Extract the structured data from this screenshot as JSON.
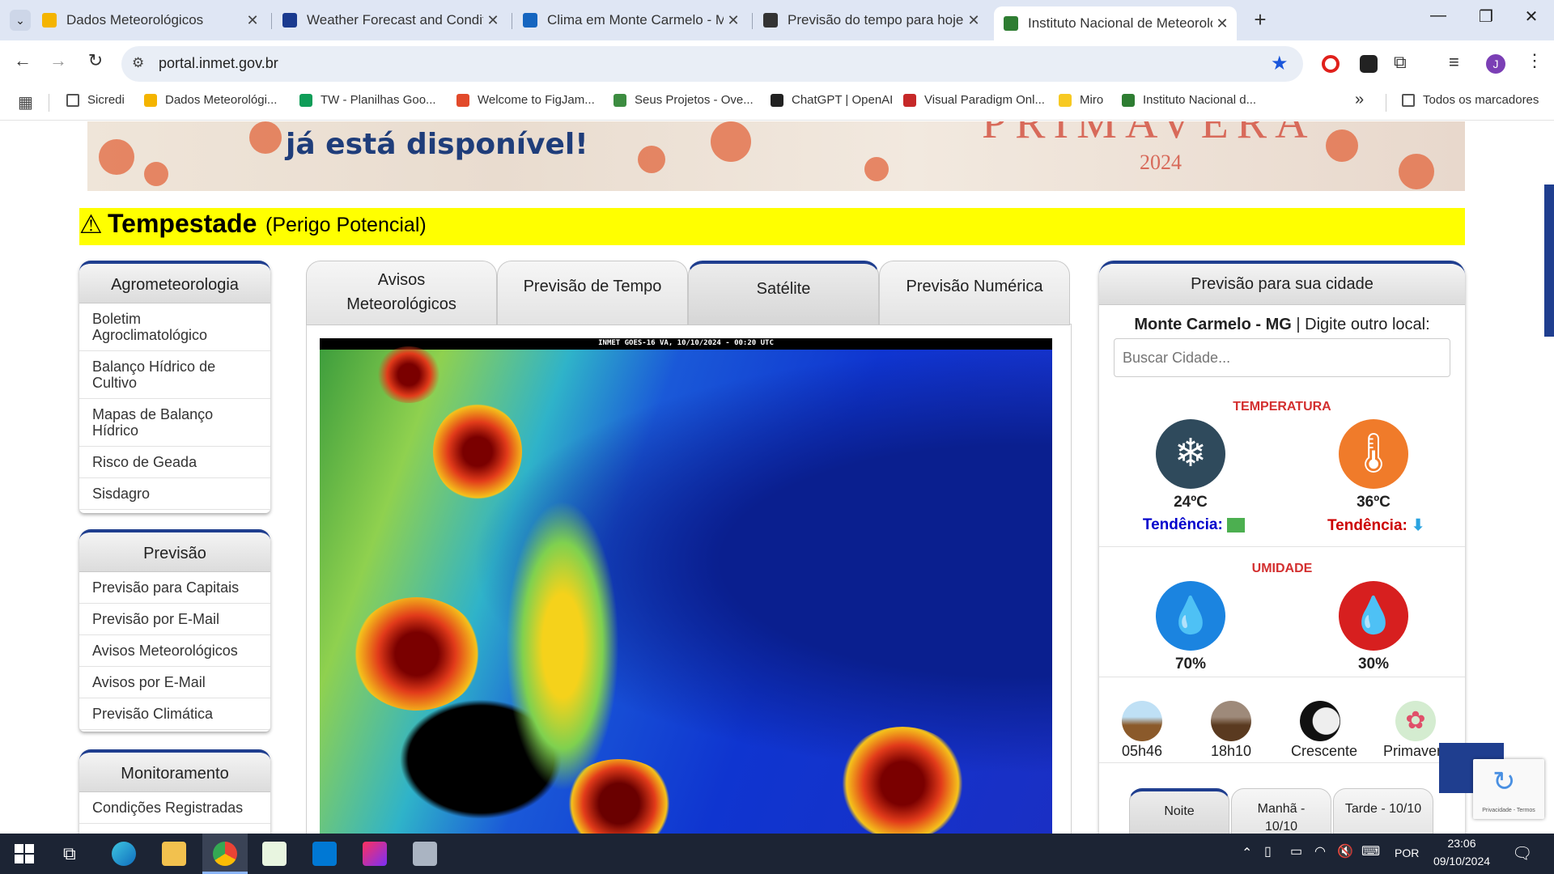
{
  "browser": {
    "tabs": [
      {
        "title": "Dados Meteorológicos",
        "icon": "sun-cloud-icon",
        "color": "#f4b400",
        "active": false
      },
      {
        "title": "Weather Forecast and Condition",
        "icon": "weather-channel-icon",
        "color": "#1a3a8f",
        "active": false
      },
      {
        "title": "Clima em Monte Carmelo - MG",
        "icon": "climate-icon",
        "color": "#1565c0",
        "active": false
      },
      {
        "title": "Previsão do tempo para hoje em",
        "icon": "tempo-agora-icon",
        "color": "#333333",
        "active": false
      },
      {
        "title": "Instituto Nacional de Meteorolo",
        "icon": "inmet-icon",
        "color": "#2e7d32",
        "active": true
      }
    ],
    "new_tab": "+",
    "url": "portal.inmet.gov.br",
    "bookmarks": [
      {
        "label": "Sicredi",
        "icon": "folder-icon",
        "color": "#555555"
      },
      {
        "label": "Dados Meteorológi...",
        "icon": "sun-cloud-icon",
        "color": "#f4b400"
      },
      {
        "label": "TW - Planilhas Goo...",
        "icon": "sheets-icon",
        "color": "#0f9d58"
      },
      {
        "label": "Welcome to FigJam...",
        "icon": "figma-icon",
        "color": "#e24a2b"
      },
      {
        "label": "Seus Projetos - Ove...",
        "icon": "overleaf-icon",
        "color": "#3c8c40"
      },
      {
        "label": "ChatGPT | OpenAI",
        "icon": "openai-icon",
        "color": "#222222"
      },
      {
        "label": "Visual Paradigm Onl...",
        "icon": "visual-paradigm-icon",
        "color": "#c62828"
      },
      {
        "label": "Miro",
        "icon": "miro-icon",
        "color": "#f7c922"
      },
      {
        "label": "Instituto Nacional d...",
        "icon": "inmet-icon",
        "color": "#2e7d32"
      }
    ],
    "more_bookmarks": "»",
    "all_bookmarks": "Todos os marcadores"
  },
  "banner": {
    "text": "já está disponível!",
    "season": "PRIMAVERA",
    "year": "2024"
  },
  "alert": {
    "title": "Tempestade",
    "subtitle": "(Perigo Potencial)"
  },
  "sidebar": [
    {
      "header": "Agrometeorologia",
      "items": [
        "Boletim Agroclimatológico",
        "Balanço Hídrico de Cultivo",
        "Mapas de Balanço Hídrico",
        "Risco de Geada",
        "Sisdagro"
      ]
    },
    {
      "header": "Previsão",
      "items": [
        "Previsão para Capitais",
        "Previsão por E-Mail",
        "Avisos Meteorológicos",
        "Avisos por E-Mail",
        "Previsão Climática"
      ]
    },
    {
      "header": "Monitoramento",
      "items": [
        "Condições Registradas"
      ]
    }
  ],
  "center_tabs": [
    "Avisos Meteorológicos",
    "Previsão de Tempo",
    "Satélite",
    "Previsão Numérica"
  ],
  "selected_center_tab": "Satélite",
  "satellite_caption": "INMET GOES-16 VA, 10/10/2024 - 00:20 UTC",
  "city_panel": {
    "header": "Previsão para sua cidade",
    "city": "Monte Carmelo - MG",
    "separator": "|",
    "prompt": "Digite outro local:",
    "search_placeholder": "Buscar Cidade...",
    "temperature_label": "TEMPERATURA",
    "min_temp": "24ºC",
    "max_temp": "36ºC",
    "trend_label": "Tendência:",
    "humidity_label": "UMIDADE",
    "max_humidity": "70%",
    "min_humidity": "30%",
    "sunrise": "05h46",
    "sunset": "18h10",
    "moon": "Crescente",
    "season": "Primavera",
    "period_tabs": [
      "Noite",
      "Manhã - 10/10",
      "Tarde - 10/10"
    ],
    "colors": {
      "cold": "#2f4a5c",
      "hot": "#f07b2a",
      "humid_high": "#1b84e0",
      "humid_low": "#d71f1f",
      "trend_cold": "#0000cc",
      "trend_hot": "#cc0000",
      "label_red": "#d32f2f"
    }
  },
  "recaptcha": {
    "text": "Privacidade - Termos"
  },
  "taskbar": {
    "language": "POR",
    "time": "23:06",
    "date": "09/10/2024"
  }
}
